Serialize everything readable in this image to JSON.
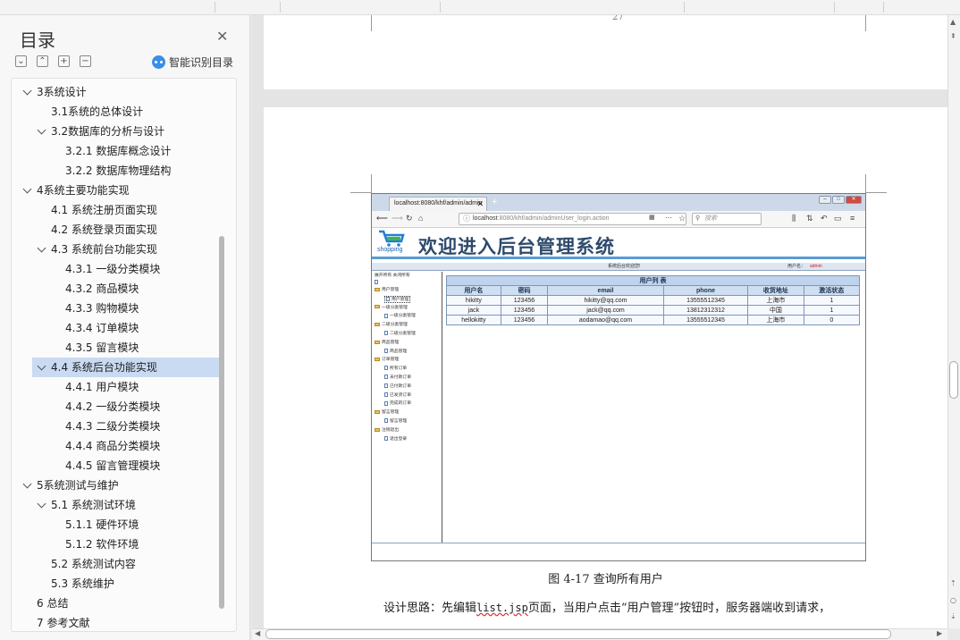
{
  "sidebar": {
    "title": "目录",
    "smart_label": "智能识别目录",
    "toc": [
      {
        "label": "3系统设计",
        "level": 0,
        "expanded": true
      },
      {
        "label": "3.1系统的总体设计",
        "level": 1
      },
      {
        "label": "3.2数据库的分析与设计",
        "level": 1,
        "expanded": true
      },
      {
        "label": "3.2.1 数据库概念设计",
        "level": 2
      },
      {
        "label": "3.2.2 数据库物理结构",
        "level": 2
      },
      {
        "label": "4系统主要功能实现",
        "level": 0,
        "expanded": true
      },
      {
        "label": "4.1 系统注册页面实现",
        "level": 1
      },
      {
        "label": "4.2 系统登录页面实现",
        "level": 1
      },
      {
        "label": "4.3 系统前台功能实现",
        "level": 1,
        "expanded": true
      },
      {
        "label": "4.3.1 一级分类模块",
        "level": 2
      },
      {
        "label": "4.3.2 商品模块",
        "level": 2
      },
      {
        "label": "4.3.3 购物模块",
        "level": 2
      },
      {
        "label": "4.3.4 订单模块",
        "level": 2
      },
      {
        "label": "4.3.5 留言模块",
        "level": 2
      },
      {
        "label": "4.4 系统后台功能实现",
        "level": 1,
        "expanded": true,
        "selected": true
      },
      {
        "label": "4.4.1 用户模块",
        "level": 2
      },
      {
        "label": "4.4.2 一级分类模块",
        "level": 2
      },
      {
        "label": "4.4.3 二级分类模块",
        "level": 2
      },
      {
        "label": "4.4.4 商品分类模块",
        "level": 2
      },
      {
        "label": "4.4.5 留言管理模块",
        "level": 2
      },
      {
        "label": "5系统测试与维护",
        "level": 0,
        "expanded": true
      },
      {
        "label": "5.1 系统测试环境",
        "level": 1,
        "expanded": true
      },
      {
        "label": "5.1.1 硬件环境",
        "level": 2
      },
      {
        "label": "5.1.2 软件环境",
        "level": 2
      },
      {
        "label": "5.2 系统测试内容",
        "level": 1
      },
      {
        "label": "5.3 系统维护",
        "level": 1
      },
      {
        "label": "6 总结",
        "level": 0
      },
      {
        "label": "7 参考文献",
        "level": 0
      }
    ]
  },
  "document": {
    "page_number": "27",
    "figure_caption": "图 4-17 查询所有用户",
    "body_prefix": "设计思路：先编辑",
    "body_code": "list.jsp",
    "body_suffix": "页面，当用户点击“用户管理”按钮时，服务器端收到请求，"
  },
  "browser": {
    "tab_title": "localhost:8080/khf/admin/admin",
    "url_host": "localhost",
    "url_path": ":8080/khf/admin/adminUser_login.action",
    "search_placeholder": "搜索",
    "logo_text": "shopping",
    "banner_title": "欢迎进入后台管理系统",
    "info_center": "系统后台欢迎您!",
    "info_user_label": "用户名：",
    "info_user_value": "admin",
    "tree_controls": "展开所有  关闭所有",
    "tree": [
      {
        "label": "用户管理",
        "type": "folder",
        "indent": 0
      },
      {
        "label": "用户管理",
        "type": "page",
        "indent": 1,
        "highlighted": true
      },
      {
        "label": "一级分类管理",
        "type": "folder",
        "indent": 0
      },
      {
        "label": "一级分类管理",
        "type": "page",
        "indent": 1
      },
      {
        "label": "二级分类管理",
        "type": "folder",
        "indent": 0
      },
      {
        "label": "二级分类管理",
        "type": "page",
        "indent": 1
      },
      {
        "label": "商品管理",
        "type": "folder",
        "indent": 0
      },
      {
        "label": "商品管理",
        "type": "page",
        "indent": 1
      },
      {
        "label": "订单管理",
        "type": "folder",
        "indent": 0
      },
      {
        "label": "所有订单",
        "type": "page",
        "indent": 1
      },
      {
        "label": "未付款订单",
        "type": "page",
        "indent": 1
      },
      {
        "label": "已付款订单",
        "type": "page",
        "indent": 1
      },
      {
        "label": "已发货订单",
        "type": "page",
        "indent": 1
      },
      {
        "label": "完成的订单",
        "type": "page",
        "indent": 1
      },
      {
        "label": "留言管理",
        "type": "folder",
        "indent": 0
      },
      {
        "label": "留言管理",
        "type": "page",
        "indent": 1
      },
      {
        "label": "注销退出",
        "type": "folder",
        "indent": 0
      },
      {
        "label": "退出登录",
        "type": "page",
        "indent": 1
      }
    ],
    "table": {
      "caption": "用户列 表",
      "headers": [
        "用户名",
        "密码",
        "email",
        "phone",
        "收货地址",
        "激活状态"
      ],
      "rows": [
        [
          "hikitty",
          "123456",
          "hikitty@qq.com",
          "13555512345",
          "上海市",
          "1"
        ],
        [
          "jack",
          "123456",
          "jack@qq.com",
          "13812312312",
          "中国",
          "1"
        ],
        [
          "hellokitty",
          "123456",
          "aodamao@qq.com",
          "13555512345",
          "上海市",
          "0"
        ]
      ]
    }
  },
  "colors": {
    "toc_selected": "#c9daf3",
    "banner_title": "#2e4a6b",
    "table_border": "#7d97b7",
    "admin_user": "#d22222"
  }
}
